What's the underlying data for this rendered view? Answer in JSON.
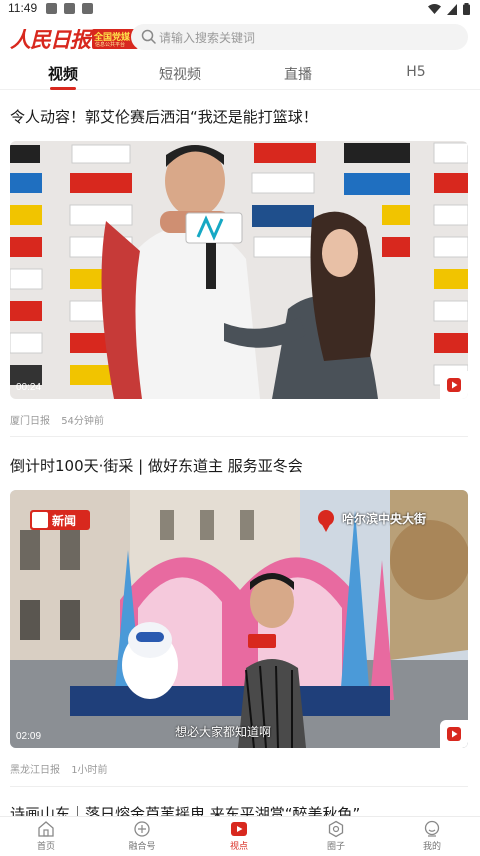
{
  "status_bar": {
    "time": "11:49"
  },
  "header": {
    "logo_text": "人民日报",
    "logo_badge_text": "全国党媒",
    "logo_badge_sub": "信息公共平台",
    "search_placeholder": "请输入搜索关键词"
  },
  "tabs": [
    {
      "label": "视频",
      "active": true
    },
    {
      "label": "短视频",
      "active": false
    },
    {
      "label": "直播",
      "active": false
    },
    {
      "label": "H5",
      "active": false
    }
  ],
  "feed": [
    {
      "title": "令人动容！郭艾伦赛后洒泪“我还是能打篮球！",
      "duration": "00:24",
      "source": "厦门日报",
      "time": "54分钟前"
    },
    {
      "title": "倒计时100天·街采 | 做好东道主 服务亚冬会",
      "duration": "02:09",
      "source": "黑龙江日报",
      "time": "1小时前",
      "overlay_brand": "新闻",
      "overlay_location": "哈尔滨中央大街",
      "overlay_subtitle": "想必大家都知道啊"
    },
    {
      "title": "诗画山东｜落日熔金芦苇摇曳 来东平湖赏“醉美秋色”"
    }
  ],
  "bottom_nav": [
    {
      "label": "首页",
      "icon": "home-icon",
      "active": false
    },
    {
      "label": "融合号",
      "icon": "media-icon",
      "active": false
    },
    {
      "label": "视点",
      "icon": "video-icon",
      "active": true
    },
    {
      "label": "圈子",
      "icon": "circle-icon",
      "active": false
    },
    {
      "label": "我的",
      "icon": "user-icon",
      "active": false
    }
  ],
  "colors": {
    "accent": "#d8281e",
    "text": "#1a1a1a",
    "meta": "#999999"
  }
}
